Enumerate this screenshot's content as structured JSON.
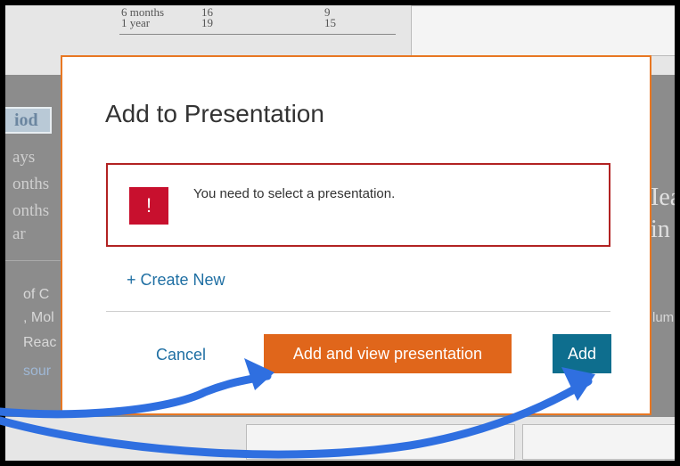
{
  "background": {
    "table_rows": [
      {
        "label": "6 months",
        "col1": "16",
        "col2": "9"
      },
      {
        "label": "1 year",
        "col1": "19",
        "col2": "15"
      }
    ],
    "period_header": "iod",
    "period_rows": [
      "ays",
      "onths",
      "onths",
      "ar"
    ],
    "right_fragments": [
      "Iea",
      "in"
    ],
    "left_fragments": [
      "of C",
      ", Mol",
      "Reac",
      "sour"
    ],
    "right_small": "lum"
  },
  "modal": {
    "title": "Add to Presentation",
    "alert": {
      "icon": "!",
      "message": "You need to select a presentation."
    },
    "create_new_label": "+ Create New",
    "buttons": {
      "cancel": "Cancel",
      "add_and_view": "Add and view presentation",
      "add": "Add"
    }
  },
  "colors": {
    "accent_orange": "#e87722",
    "button_orange": "#e0661b",
    "button_teal": "#0e6e8e",
    "alert_red": "#c8102e",
    "link_blue": "#1f6fa3",
    "annotation_arrow": "#2f6fe0"
  }
}
